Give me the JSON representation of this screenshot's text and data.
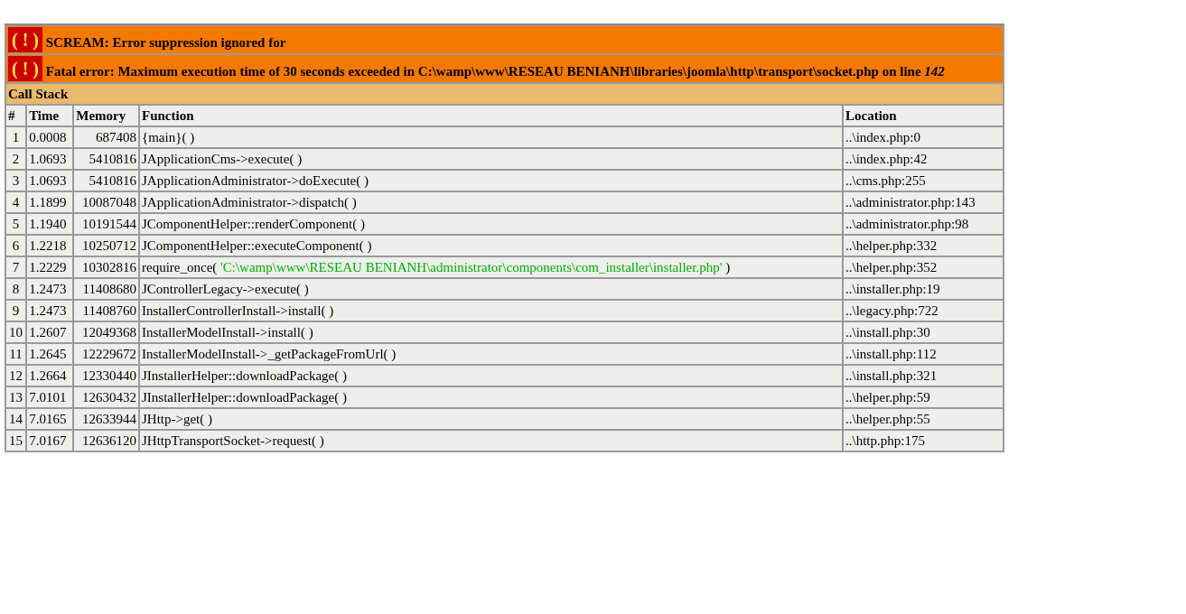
{
  "messages": [
    {
      "icon": "( ! )",
      "text": "SCREAM: Error suppression ignored for"
    },
    {
      "icon": "( ! )",
      "text": "Fatal error: Maximum execution time of 30 seconds exceeded in C:\\wamp\\www\\RESEAU BENIANH\\libraries\\joomla\\http\\transport\\socket.php on line *142*"
    }
  ],
  "call_stack": {
    "title": "Call Stack",
    "columns": [
      "#",
      "Time",
      "Memory",
      "Function",
      "Location"
    ],
    "rows": [
      {
        "index": "1",
        "time": "0.0008",
        "memory": "687408",
        "function": [
          {
            "kind": "call",
            "text": "{main}( )"
          }
        ],
        "location": "..\\index.php:0"
      },
      {
        "index": "2",
        "time": "1.0693",
        "memory": "5410816",
        "function": [
          {
            "kind": "call",
            "text": "JApplicationCms->execute( )"
          }
        ],
        "location": "..\\index.php:42"
      },
      {
        "index": "3",
        "time": "1.0693",
        "memory": "5410816",
        "function": [
          {
            "kind": "call",
            "text": "JApplicationAdministrator->doExecute( )"
          }
        ],
        "location": "..\\cms.php:255"
      },
      {
        "index": "4",
        "time": "1.1899",
        "memory": "10087048",
        "function": [
          {
            "kind": "call",
            "text": "JApplicationAdministrator->dispatch( )"
          }
        ],
        "location": "..\\administrator.php:143"
      },
      {
        "index": "5",
        "time": "1.1940",
        "memory": "10191544",
        "function": [
          {
            "kind": "call",
            "text": "JComponentHelper::renderComponent( )"
          }
        ],
        "location": "..\\administrator.php:98"
      },
      {
        "index": "6",
        "time": "1.2218",
        "memory": "10250712",
        "function": [
          {
            "kind": "call",
            "text": "JComponentHelper::executeComponent( )"
          }
        ],
        "location": "..\\helper.php:332"
      },
      {
        "index": "7",
        "time": "1.2229",
        "memory": "10302816",
        "function": [
          {
            "kind": "call",
            "text": "require_once( "
          },
          {
            "kind": "string",
            "text": "'C:\\wamp\\www\\RESEAU BENIANH\\administrator\\components\\com_installer\\installer.php'"
          },
          {
            "kind": "call",
            "text": " )"
          }
        ],
        "location": "..\\helper.php:352"
      },
      {
        "index": "8",
        "time": "1.2473",
        "memory": "11408680",
        "function": [
          {
            "kind": "call",
            "text": "JControllerLegacy->execute( )"
          }
        ],
        "location": "..\\installer.php:19"
      },
      {
        "index": "9",
        "time": "1.2473",
        "memory": "11408760",
        "function": [
          {
            "kind": "call",
            "text": "InstallerControllerInstall->install( )"
          }
        ],
        "location": "..\\legacy.php:722"
      },
      {
        "index": "10",
        "time": "1.2607",
        "memory": "12049368",
        "function": [
          {
            "kind": "call",
            "text": "InstallerModelInstall->install( )"
          }
        ],
        "location": "..\\install.php:30"
      },
      {
        "index": "11",
        "time": "1.2645",
        "memory": "12229672",
        "function": [
          {
            "kind": "call",
            "text": "InstallerModelInstall->_getPackageFromUrl( )"
          }
        ],
        "location": "..\\install.php:112"
      },
      {
        "index": "12",
        "time": "1.2664",
        "memory": "12330440",
        "function": [
          {
            "kind": "call",
            "text": "JInstallerHelper::downloadPackage( )"
          }
        ],
        "location": "..\\install.php:321"
      },
      {
        "index": "13",
        "time": "7.0101",
        "memory": "12630432",
        "function": [
          {
            "kind": "call",
            "text": "JInstallerHelper::downloadPackage( )"
          }
        ],
        "location": "..\\helper.php:59"
      },
      {
        "index": "14",
        "time": "7.0165",
        "memory": "12633944",
        "function": [
          {
            "kind": "call",
            "text": "JHttp->get( )"
          }
        ],
        "location": "..\\helper.php:55"
      },
      {
        "index": "15",
        "time": "7.0167",
        "memory": "12636120",
        "function": [
          {
            "kind": "call",
            "text": "JHttpTransportSocket->request( )"
          }
        ],
        "location": "..\\http.php:175"
      }
    ]
  }
}
